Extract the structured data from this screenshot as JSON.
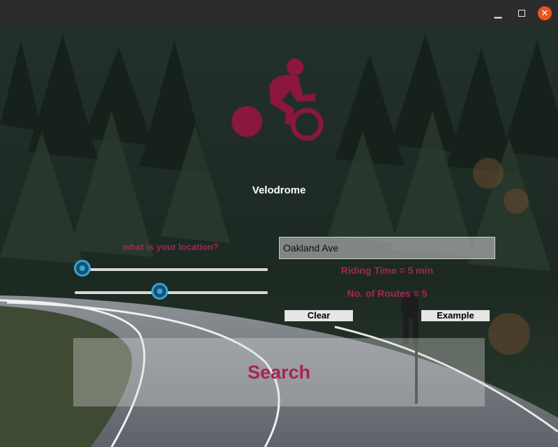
{
  "window": {
    "minimize_icon": "minimize-icon",
    "maximize_icon": "maximize-icon",
    "close_icon": "close-icon"
  },
  "app": {
    "title": "Velodrome",
    "logo_icon": "cyclist-icon",
    "accent_color": "#a7254f"
  },
  "form": {
    "location_label": "what is your location?",
    "location_value": "Oakland Ave",
    "riding_time_text": "Riding Time = 5 min",
    "routes_text": "No. of Routes = 5",
    "riding_time_slider": 0.04,
    "routes_slider": 0.44
  },
  "buttons": {
    "clear": "Clear",
    "example": "Example",
    "search": "Search"
  }
}
